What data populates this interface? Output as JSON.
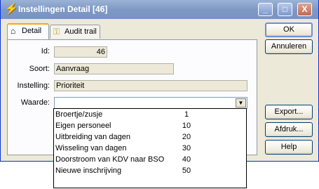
{
  "window": {
    "title": "Instellingen Detail [46]",
    "minimize": "_",
    "maximize": "□",
    "close": "X"
  },
  "tabs": [
    {
      "label": "Detail",
      "icon": "house-icon"
    },
    {
      "label": "Audit trail",
      "icon": "key-icon"
    }
  ],
  "form": {
    "id_label": "Id:",
    "id_value": "46",
    "soort_label": "Soort:",
    "soort_value": "Aanvraag",
    "instelling_label": "Instelling:",
    "instelling_value": "Prioriteit",
    "waarde_label": "Waarde:",
    "waarde_value": ""
  },
  "dropdown": {
    "items": [
      {
        "name": "Broertje/zusje",
        "value": "1"
      },
      {
        "name": "Eigen personeel",
        "value": "10"
      },
      {
        "name": "Uitbreiding van dagen",
        "value": "20"
      },
      {
        "name": "Wisseling van dagen",
        "value": "30"
      },
      {
        "name": "Doorstroom van KDV naar BSO",
        "value": "40"
      },
      {
        "name": "Nieuwe inschrijving",
        "value": "50"
      }
    ]
  },
  "buttons": {
    "ok": "OK",
    "annuleren": "Annuleren",
    "export": "Export...",
    "afdruk": "Afdruk...",
    "help": "Help"
  }
}
